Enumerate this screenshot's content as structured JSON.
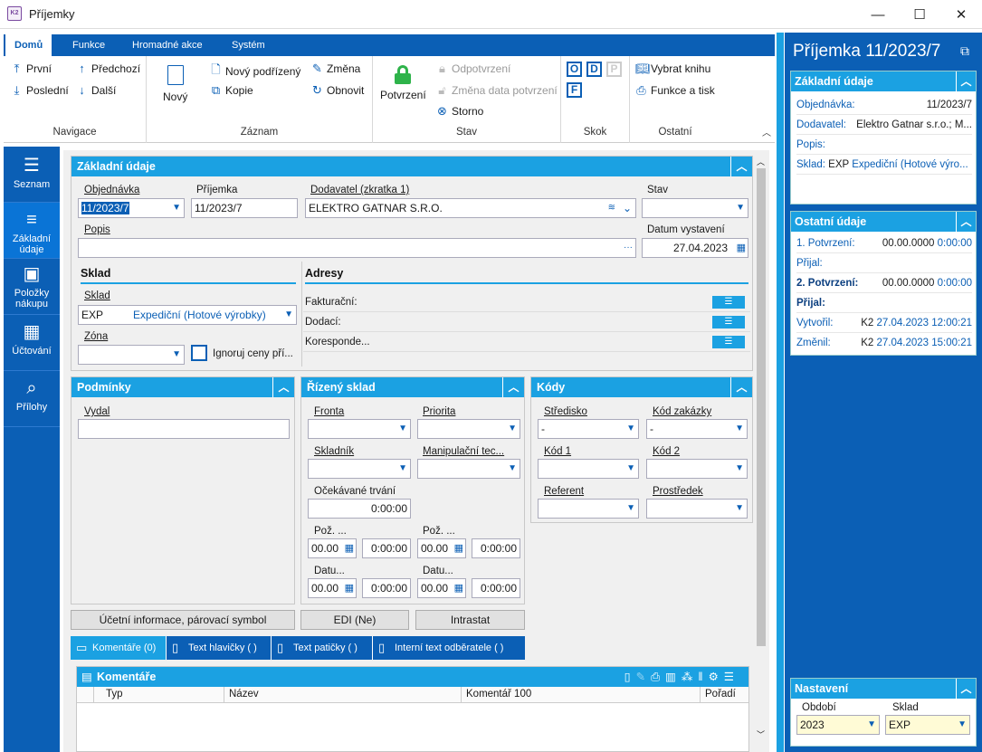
{
  "window": {
    "title": "Příjemky",
    "logo": "K2",
    "minimize": "—",
    "maximize": "☐",
    "close": "✕"
  },
  "ribbon": {
    "tabs": [
      "Domů",
      "Funkce",
      "Hromadné akce",
      "Systém"
    ],
    "nav": {
      "first": "První",
      "prev": "Předchozí",
      "last": "Poslední",
      "next": "Další",
      "label": "Navigace"
    },
    "record": {
      "new": "Nový",
      "new_sub": "Nový podřízený",
      "copy": "Kopie",
      "change": "Změna",
      "refresh": "Obnovit",
      "label": "Záznam"
    },
    "state": {
      "confirm": "Potvrzení",
      "unconfirm": "Odpotvrzení",
      "change_date": "Změna data potvrzení",
      "storno": "Storno",
      "label": "Stav"
    },
    "jump": {
      "o": "O",
      "d": "D",
      "p": "P",
      "f": "F",
      "label": "Skok"
    },
    "other": {
      "book": "Vybrat knihu",
      "print": "Funkce a tisk",
      "label": "Ostatní"
    }
  },
  "leftnav": [
    {
      "label": "Seznam"
    },
    {
      "label": "Základní údaje"
    },
    {
      "label": "Položky nákupu"
    },
    {
      "label": "Účtování"
    },
    {
      "label": "Přílohy"
    }
  ],
  "basic": {
    "title": "Základní údaje",
    "order_label": "Objednávka",
    "order_value": "11/2023/7",
    "receipt_label": "Příjemka",
    "receipt_value": "11/2023/7",
    "supplier_label": "Dodavatel (zkratka 1)",
    "supplier_value": "ELEKTRO GATNAR S.R.O.",
    "state_label": "Stav",
    "state_value": "",
    "desc_label": "Popis",
    "desc_value": "",
    "desc_more": "···",
    "date_label": "Datum vystavení",
    "date_value": "27.04.2023",
    "sklad_head": "Sklad",
    "sklad_label": "Sklad",
    "sklad_code": "EXP",
    "sklad_name": "Expediční (Hotové výrobky)",
    "zone_label": "Zóna",
    "ignore_label": "Ignoruj ceny pří...",
    "addr_head": "Adresy",
    "addr_invoice": "Fakturační:",
    "addr_delivery": "Dodací:",
    "addr_corr": "Koresponde..."
  },
  "conditions": {
    "title": "Podmínky",
    "issued_label": "Vydal"
  },
  "managed": {
    "title": "Řízený sklad",
    "queue": "Fronta",
    "priority": "Priorita",
    "storekeeper": "Skladník",
    "handling": "Manipulační tec...",
    "duration_label": "Očekávané trvání",
    "duration_value": "0:00:00",
    "req1": "Pož. ...",
    "req2": "Pož. ...",
    "dat1": "Datu...",
    "dat2": "Datu...",
    "d1": "00.00",
    "t1": "0:00:00",
    "d2": "00.00",
    "t2": "0:00:00",
    "d3": "00.00",
    "t3": "0:00:00",
    "d4": "00.00",
    "t4": "0:00:00"
  },
  "codes": {
    "title": "Kódy",
    "center": "Středisko",
    "center_value": "-",
    "order_code": "Kód zakázky",
    "order_code_value": "-",
    "code1": "Kód 1",
    "code2": "Kód 2",
    "referent": "Referent",
    "resource": "Prostředek"
  },
  "buttons": {
    "acct": "Účetní informace, párovací symbol",
    "edi": "EDI (Ne)",
    "intrastat": "Intrastat"
  },
  "bottom_tabs": [
    "Komentáře (0)",
    "Text hlavičky ( )",
    "Text patičky ( )",
    "Interní text odběratele ( )"
  ],
  "comments": {
    "title": "Komentáře",
    "cols": [
      "Typ",
      "Název",
      "Komentář 100",
      "Pořadí"
    ]
  },
  "right": {
    "header": "Příjemka 11/2023/7",
    "basic": {
      "title": "Základní údaje",
      "order_label": "Objednávka:",
      "order_value": "11/2023/7",
      "supplier_label": "Dodavatel:",
      "supplier_value": "Elektro Gatnar s.r.o.; M...",
      "desc_label": "Popis:",
      "sklad_label": "Sklad:",
      "sklad_code": "EXP",
      "sklad_name": "Expediční (Hotové výro..."
    },
    "other": {
      "title": "Ostatní údaje",
      "c1_label": "1. Potvrzení:",
      "c1_date": "00.00.0000",
      "c1_time": "0:00:00",
      "r1_label": "Přijal:",
      "c2_label": "2. Potvrzení:",
      "c2_date": "00.00.0000",
      "c2_time": "0:00:00",
      "r2_label": "Přijal:",
      "created_label": "Vytvořil:",
      "created_user": "K2",
      "created_value": "27.04.2023 12:00:21",
      "changed_label": "Změnil:",
      "changed_user": "K2",
      "changed_value": "27.04.2023 15:00:21"
    },
    "settings": {
      "title": "Nastavení",
      "period_label": "Období",
      "period_value": "2023",
      "store_label": "Sklad",
      "store_value": "EXP"
    }
  },
  "colors": {
    "brand": "#0b5fb5",
    "accent": "#1ba1e2",
    "confirm": "#2eb34a"
  }
}
